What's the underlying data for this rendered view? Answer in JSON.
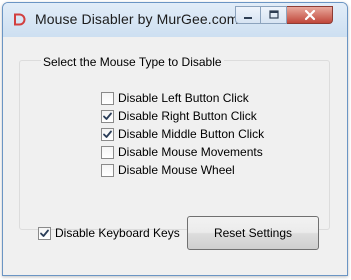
{
  "window": {
    "title": "Mouse Disabler by MurGee.com",
    "accent_color": "#d23f3f",
    "app_icon": "murgee-d-icon",
    "caption_icons": [
      "minimize-icon",
      "maximize-icon",
      "close-icon"
    ]
  },
  "group": {
    "label": "Select the Mouse Type to Disable",
    "options": [
      {
        "label": "Disable Left Button Click",
        "checked": false
      },
      {
        "label": "Disable Right Button Click",
        "checked": true
      },
      {
        "label": "Disable Middle Button Click",
        "checked": true
      },
      {
        "label": "Disable Mouse Movements",
        "checked": false
      },
      {
        "label": "Disable Mouse Wheel",
        "checked": false
      }
    ]
  },
  "keyboard": {
    "label": "Disable Keyboard Keys",
    "checked": true
  },
  "reset_button": {
    "label": "Reset Settings"
  }
}
